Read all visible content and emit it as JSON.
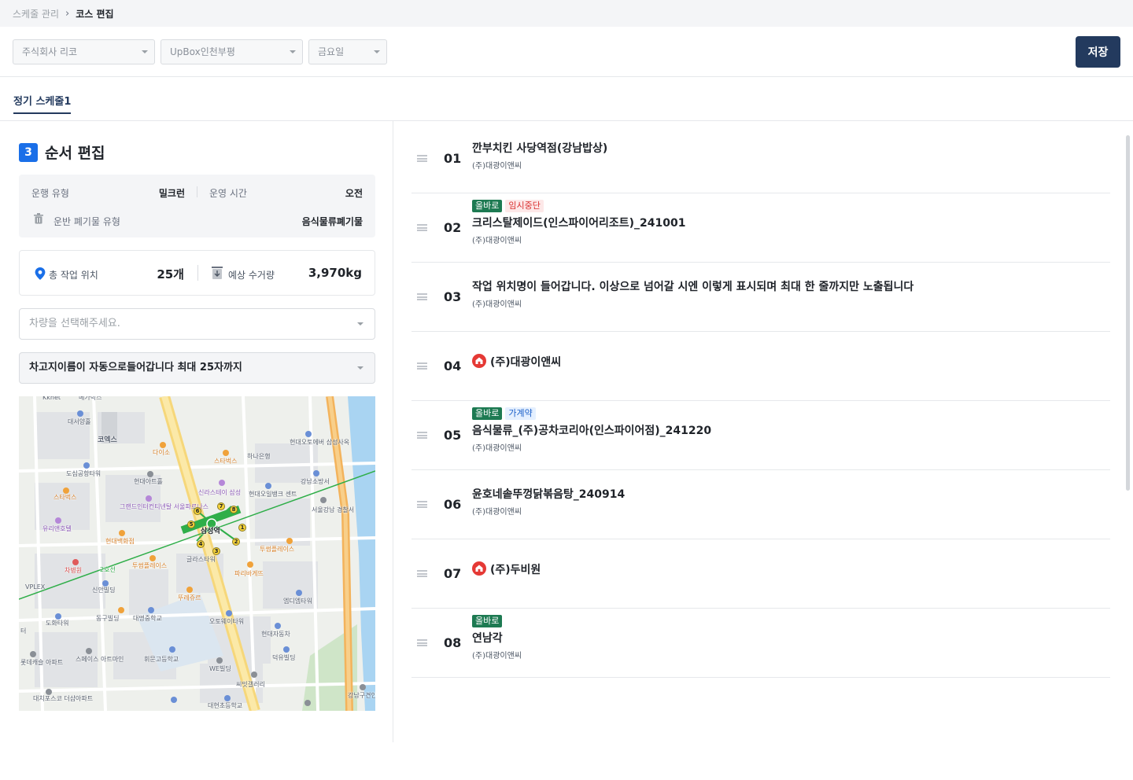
{
  "breadcrumb": {
    "parent": "스케줄 관리",
    "current": "코스 편집"
  },
  "filters": {
    "company": "주식회사 리코",
    "site": "UpBox인천부평",
    "day": "금요일",
    "save_label": "저장"
  },
  "tabs": [
    {
      "label": "정기 스케줄1"
    }
  ],
  "section": {
    "number": "3",
    "title": "순서 편집"
  },
  "info": {
    "run_type_label": "운행 유형",
    "run_type_value": "밀크런",
    "run_time_label": "운영 시간",
    "run_time_value": "오전",
    "waste_type_label": "운반 폐기물 유형",
    "waste_type_value": "음식물류폐기물"
  },
  "stats": {
    "locations_label": "총 작업 위치",
    "locations_value": "25개",
    "amount_label": "예상 수거량",
    "amount_value": "3,970kg"
  },
  "vehicle_select": {
    "placeholder": "차량을 선택해주세요."
  },
  "garage_select": {
    "value": "차고지이름이 자동으로들어갑니다 최대 25자까지"
  },
  "map": {
    "labels": [
      "Kkhet",
      "메가박스",
      "대서양홀",
      "코엑스",
      "다이소",
      "스타벅스",
      "하나은행",
      "현대오토에버 삼성사옥",
      "도심공항타워",
      "현대아트홀",
      "스타벅스",
      "강남소방서",
      "신라스테이 삼성",
      "현대오일뱅크 센트",
      "서울강남 경찰서",
      "그랜드인터컨티넨탈 서울파르나스",
      "유리앤호텔",
      "현대백화점",
      "삼성역",
      "투썸플레이스",
      "차병원",
      "투썸플레이스",
      "글라스타워",
      "파리바게뜨",
      "VPLEX",
      "신안빌딩",
      "뚜레쥬르",
      "엠디엠타워",
      "도화타워",
      "동구빌딩",
      "대명중학교",
      "오토웨이타워",
      "현대자동차",
      "롯데캐슬 아파트",
      "스페이스 아트마인",
      "휘문고등학교",
      "WE빌딩",
      "덕유빌딩",
      "씨밋갤러리",
      "대치포스코 더샵아파트",
      "대현초등학교",
      "강남구견인 차량보관소",
      "2호선",
      "터"
    ],
    "line": "2호선",
    "station": "삼성역",
    "exits": [
      "1",
      "2",
      "3",
      "4",
      "5",
      "6",
      "7",
      "8"
    ]
  },
  "stops": [
    {
      "num": "01",
      "title": "깐부치킨 사당역점(강남밥상)",
      "sub": "(주)대광이앤씨",
      "badges": [],
      "home": false
    },
    {
      "num": "02",
      "title": "크리스탈제이드(인스파이어리조트)_241001",
      "sub": "(주)대광이앤씨",
      "badges": [
        {
          "text": "올바로",
          "kind": "green"
        },
        {
          "text": "임시중단",
          "kind": "red"
        }
      ],
      "home": false
    },
    {
      "num": "03",
      "title": "작업 위치명이 들어갑니다. 이상으로 넘어갈 시엔 이렇게 표시되며 최대 한 줄까지만 노출됩니다",
      "sub": "(주)대광이앤씨",
      "badges": [],
      "home": false
    },
    {
      "num": "04",
      "title": "(주)대광이앤씨",
      "sub": "",
      "badges": [],
      "home": true
    },
    {
      "num": "05",
      "title": "음식물류_(주)공차코리아(인스파이어점)_241220",
      "sub": "(주)대광이앤씨",
      "badges": [
        {
          "text": "올바로",
          "kind": "green"
        },
        {
          "text": "가계약",
          "kind": "blue"
        }
      ],
      "home": false
    },
    {
      "num": "06",
      "title": "윤호네솥뚜껑닭볶음탕_240914",
      "sub": "(주)대광이앤씨",
      "badges": [],
      "home": false
    },
    {
      "num": "07",
      "title": "(주)두비원",
      "sub": "",
      "badges": [],
      "home": true
    },
    {
      "num": "08",
      "title": "연남각",
      "sub": "(주)대광이앤씨",
      "badges": [
        {
          "text": "올바로",
          "kind": "green"
        }
      ],
      "home": false
    }
  ],
  "colors": {
    "primary": "#233a5e",
    "accent": "#1a6fe8",
    "green": "#1d7a52",
    "red": "#d93030",
    "home": "#e53935"
  },
  "icons": [
    "chevron-right-icon",
    "chevron-down-icon",
    "trash-icon",
    "location-pin-icon",
    "download-icon",
    "drag-handle-icon",
    "home-icon"
  ]
}
